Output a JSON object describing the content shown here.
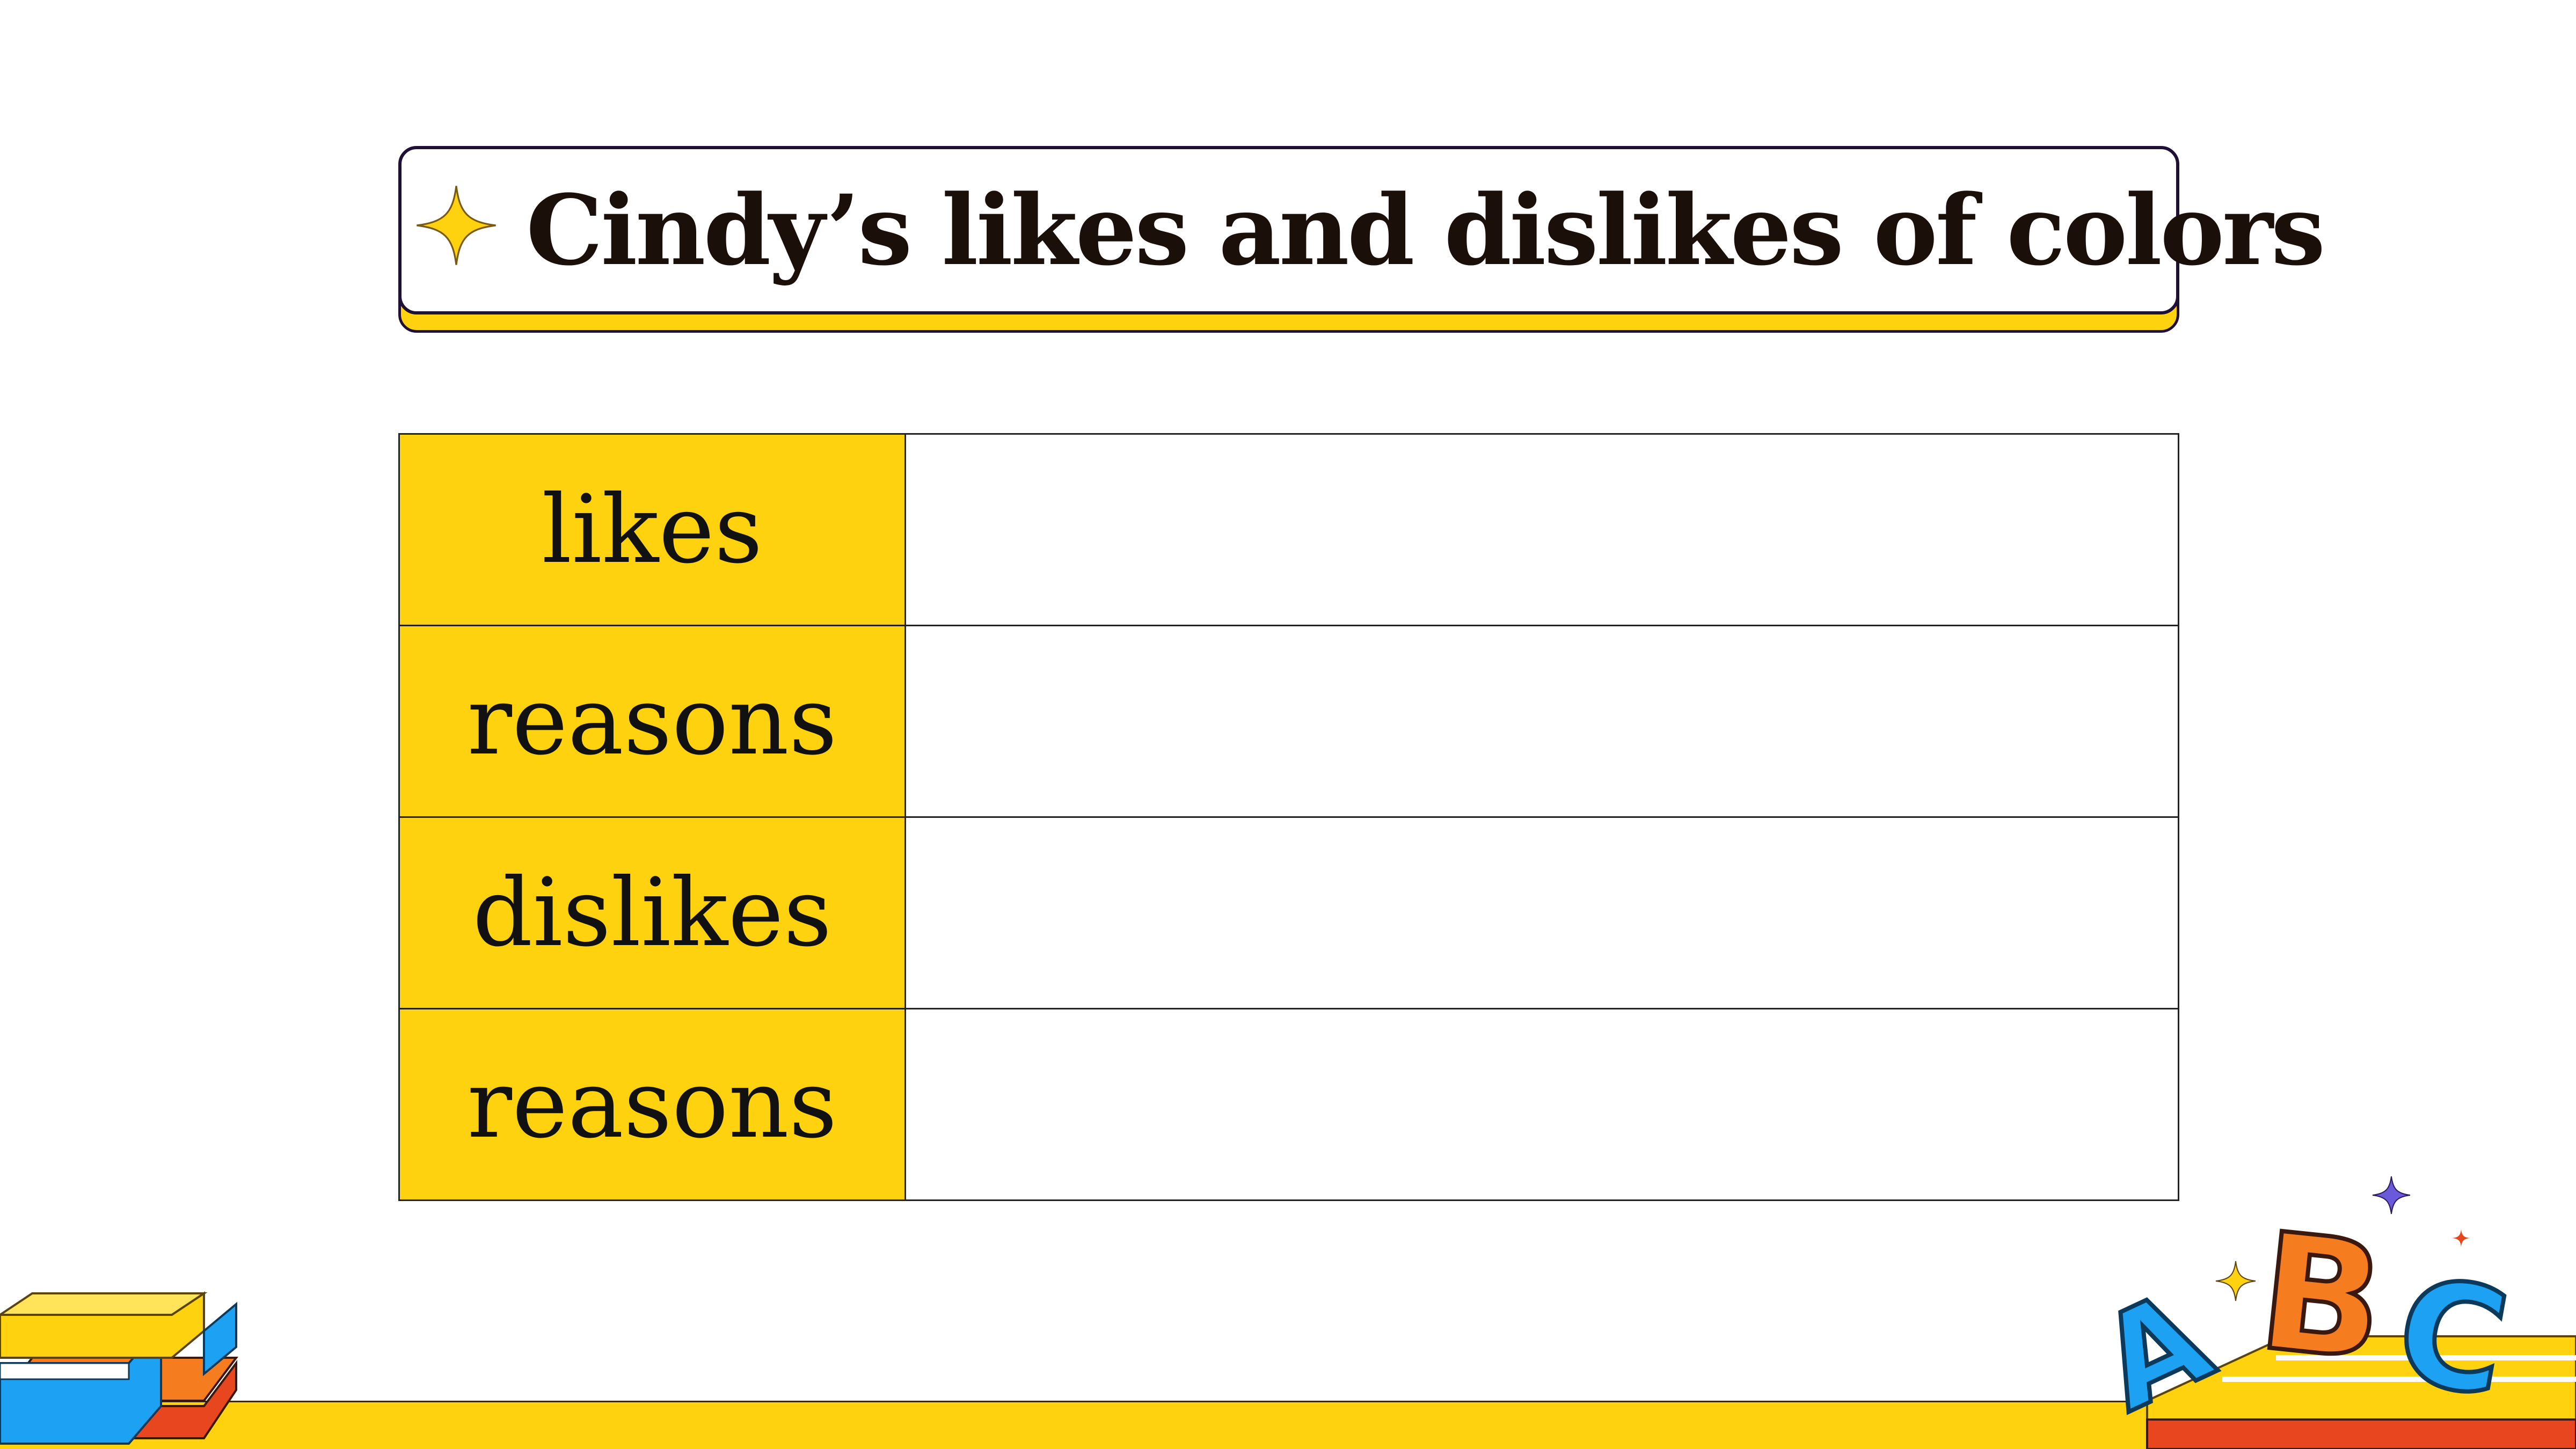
{
  "title": {
    "text": "Cindy’s likes and dislikes of colors"
  },
  "table": {
    "rows": [
      {
        "label": "likes",
        "value": ""
      },
      {
        "label": "reasons",
        "value": ""
      },
      {
        "label": "dislikes",
        "value": ""
      },
      {
        "label": "reasons",
        "value": ""
      }
    ]
  },
  "decorations": {
    "letters": [
      "A",
      "B",
      "C"
    ]
  },
  "colors": {
    "accent_yellow": "#FFD20F",
    "outline": "#1E1036",
    "blue": "#1DA1F2",
    "orange": "#F57C1F",
    "red": "#E8461E"
  }
}
